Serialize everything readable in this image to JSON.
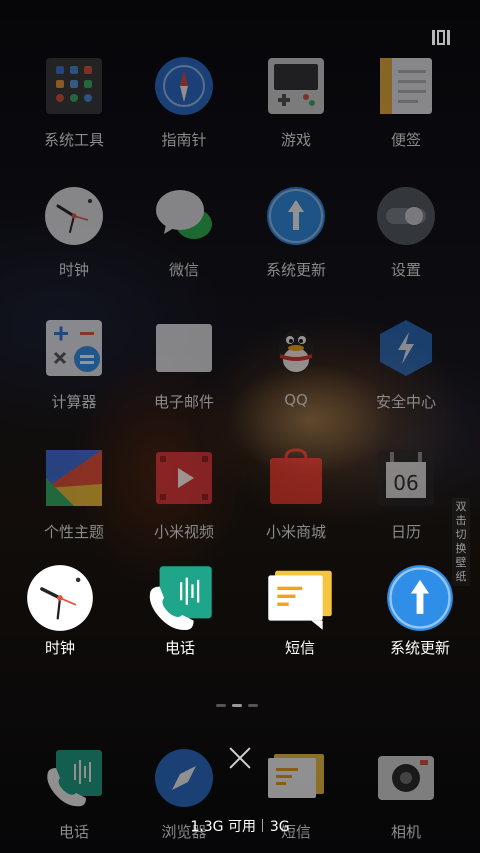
{
  "home_grid": {
    "row1": [
      {
        "label": "系统工具",
        "icon": "tools-folder-icon"
      },
      {
        "label": "指南针",
        "icon": "compass-icon"
      },
      {
        "label": "游戏",
        "icon": "game-folder-icon"
      },
      {
        "label": "便签",
        "icon": "notes-icon"
      }
    ],
    "row2": [
      {
        "label": "时钟",
        "icon": "clock-icon"
      },
      {
        "label": "微信",
        "icon": "wechat-icon"
      },
      {
        "label": "系统更新",
        "icon": "update-icon"
      },
      {
        "label": "设置",
        "icon": "settings-icon"
      }
    ],
    "row3": [
      {
        "label": "计算器",
        "icon": "calculator-icon"
      },
      {
        "label": "电子邮件",
        "icon": "email-icon"
      },
      {
        "label": "QQ",
        "icon": "qq-icon"
      },
      {
        "label": "安全中心",
        "icon": "security-icon"
      }
    ],
    "row4": [
      {
        "label": "个性主题",
        "icon": "themes-icon"
      },
      {
        "label": "小米视频",
        "icon": "video-icon"
      },
      {
        "label": "小米商城",
        "icon": "store-icon"
      },
      {
        "label": "日历",
        "icon": "calendar-icon",
        "day": "06"
      }
    ]
  },
  "recent_apps": [
    {
      "label": "时钟",
      "icon": "clock-icon"
    },
    {
      "label": "电话",
      "icon": "phone-icon"
    },
    {
      "label": "短信",
      "icon": "message-icon"
    },
    {
      "label": "系统更新",
      "icon": "update-icon"
    }
  ],
  "dock": [
    {
      "label": "电话",
      "icon": "phone-icon"
    },
    {
      "label": "浏览器",
      "icon": "browser-icon"
    },
    {
      "label": "短信",
      "icon": "message-icon"
    },
    {
      "label": "相机",
      "icon": "camera-icon"
    }
  ],
  "side_tip": "双击切换壁纸",
  "memory": {
    "available": "1.3G 可用",
    "total": "3G"
  },
  "colors": {
    "accent_blue": "#2f8fe8",
    "green": "#1ea58a",
    "yellow": "#f6c540"
  }
}
